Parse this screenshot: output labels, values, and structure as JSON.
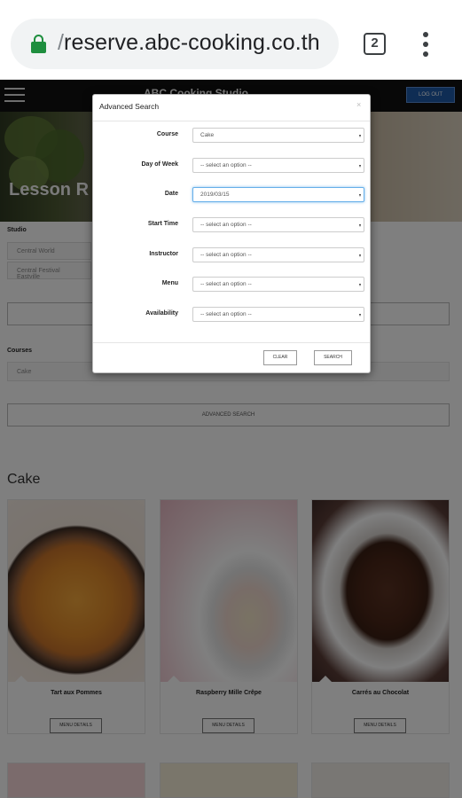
{
  "browser": {
    "url_prefix": "/",
    "url": "reserve.abc-cooking.co.th",
    "tab_count": "2"
  },
  "site": {
    "brand": "ABC Cooking Studio",
    "logout_label": "LOG OUT",
    "hero_title": "Lesson R",
    "studio_label": "Studio",
    "studios": [
      "Central World",
      "Central Festival Eastville"
    ],
    "courses_label": "Courses",
    "course_selected": "Cake",
    "advanced_search_label": "ADVANCED SEARCH",
    "section_title": "Cake",
    "cards": [
      {
        "name": "Tart aux Pommes",
        "button": "MENU DETAILS"
      },
      {
        "name": "Raspberry Mille Crêpe",
        "button": "MENU DETAILS"
      },
      {
        "name": "Carrés au Chocolat",
        "button": "MENU DETAILS"
      }
    ]
  },
  "modal": {
    "title": "Advanced Search",
    "close": "×",
    "fields": [
      {
        "label": "Course",
        "value": "Cake"
      },
      {
        "label": "Day of Week",
        "value": "-- select an option --"
      },
      {
        "label": "Date",
        "value": "2019/03/15"
      },
      {
        "label": "Start Time",
        "value": "-- select an option --"
      },
      {
        "label": "Instructor",
        "value": "-- select an option --"
      },
      {
        "label": "Menu",
        "value": "-- select an option --"
      },
      {
        "label": "Availability",
        "value": "-- select an option --"
      }
    ],
    "clear_label": "CLEAR",
    "search_label": "SEARCH"
  },
  "colors": {
    "lock": "#1e8e3e",
    "nav_bg": "#111111",
    "logout_bg": "#1e5aa8",
    "focus_border": "#66afe9"
  }
}
